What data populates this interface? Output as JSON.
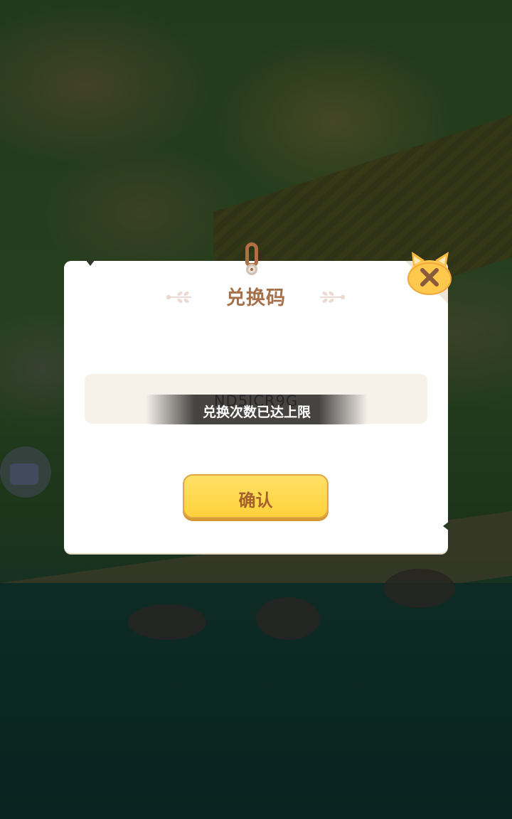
{
  "dialog": {
    "title": "兑换码",
    "code_value": "ND5ICR9G",
    "confirm_label": "确认",
    "close_icon": "close-icon"
  },
  "toast": {
    "message": "兑换次数已达上限"
  },
  "colors": {
    "title": "#a5714a",
    "button_fill": "#ffd23b",
    "button_text": "#a4612b",
    "close_icon_fill": "#ffc94d",
    "input_bg": "#f7f1ea"
  }
}
